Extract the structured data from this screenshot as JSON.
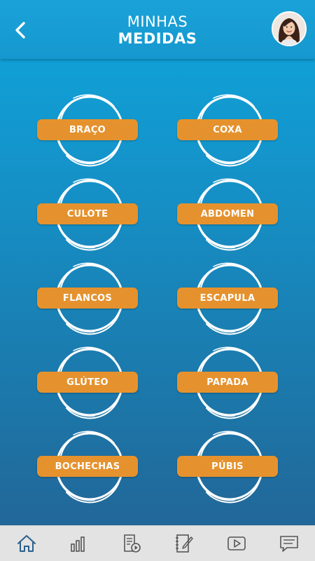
{
  "header": {
    "title_line1": "MINHAS",
    "title_line2": "MEDIDAS",
    "back_icon": "chevron-left-icon",
    "avatar": "user-avatar"
  },
  "measurements": [
    "BRAÇO",
    "COXA",
    "CULOTE",
    "ABDOMEN",
    "FLANCOS",
    "ESCAPULA",
    "GLÚTEO",
    "PAPADA",
    "BOCHECHAS",
    "PÚBIS"
  ],
  "bottom_nav": {
    "items": [
      "home-icon",
      "bar-chart-icon",
      "document-video-icon",
      "notebook-edit-icon",
      "video-play-icon",
      "chat-icon"
    ],
    "active": "home-icon"
  },
  "colors": {
    "header": "#1598cf",
    "background_top": "#0ea6dd",
    "background_bottom": "#246294",
    "pill": "#e5922e",
    "nav_bg": "#e3e3e3",
    "nav_active": "#2b5f8c",
    "nav_icon": "#555555"
  }
}
